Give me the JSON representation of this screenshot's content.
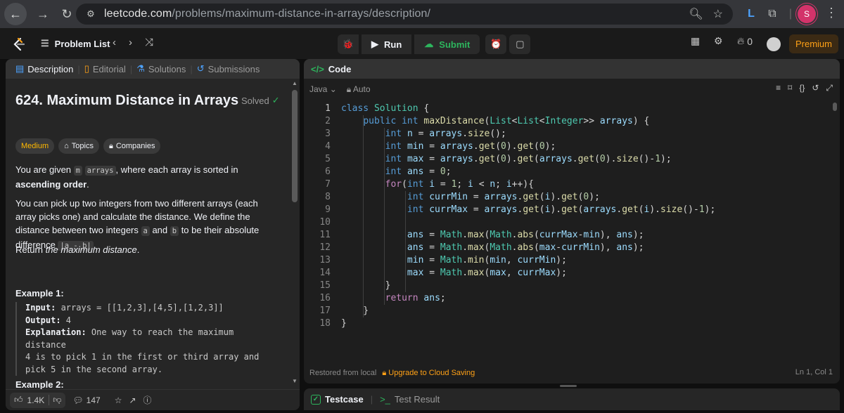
{
  "browser": {
    "url_host": "leetcode.com",
    "url_path": "/problems/maximum-distance-in-arrays/description/",
    "profile_initial": "S"
  },
  "topbar": {
    "problem_list": "Problem List",
    "run": "Run",
    "submit": "Submit",
    "notification_count": "0",
    "premium": "Premium"
  },
  "left_tabs": [
    {
      "label": "Description"
    },
    {
      "label": "Editorial"
    },
    {
      "label": "Solutions"
    },
    {
      "label": "Submissions"
    }
  ],
  "problem": {
    "title": "624. Maximum Distance in Arrays",
    "solved": "Solved",
    "difficulty": "Medium",
    "topics": "Topics",
    "companies": "Companies",
    "p1_a": "You are given ",
    "p1_code1": "m",
    "p1_code2": "arrays",
    "p1_b": ", where each array is sorted in ",
    "p1_bold": "ascending order",
    "p1_c": ".",
    "p2_a": "You can pick up two integers from two different arrays (each array picks one) and calculate the distance. We define the distance between two integers ",
    "p2_code_a": "a",
    "p2_and": " and ",
    "p2_code_b": "b",
    "p2_b": " to be their absolute difference ",
    "p2_code_abs": "|a - b|",
    "p2_c": ".",
    "p3_a": "Return ",
    "p3_em": "the maximum distance",
    "p3_b": ".",
    "example1_title": "Example 1:",
    "ex_input_label": "Input:",
    "ex_input": " arrays = [[1,2,3],[4,5],[1,2,3]]",
    "ex_output_label": "Output:",
    "ex_output": " 4",
    "ex_expl_label": "Explanation:",
    "ex_expl_1": " One way to reach the maximum distance",
    "ex_expl_2": "4 is to pick 1 in the first or third array and",
    "ex_expl_3": "pick 5 in the second array.",
    "example2_title": "Example 2:"
  },
  "left_footer": {
    "likes": "1.4K",
    "comments": "147"
  },
  "code_panel": {
    "tab": "Code",
    "language": "Java",
    "auto": "Auto",
    "footer_left": "Restored from local",
    "footer_upgrade": "Upgrade to Cloud Saving",
    "cursor": "Ln 1, Col 1"
  },
  "code_lines": [
    "1",
    "2",
    "3",
    "4",
    "5",
    "6",
    "7",
    "8",
    "9",
    "10",
    "11",
    "12",
    "13",
    "14",
    "15",
    "16",
    "17",
    "18"
  ],
  "test_panel": {
    "testcase": "Testcase",
    "result": "Test Result"
  }
}
